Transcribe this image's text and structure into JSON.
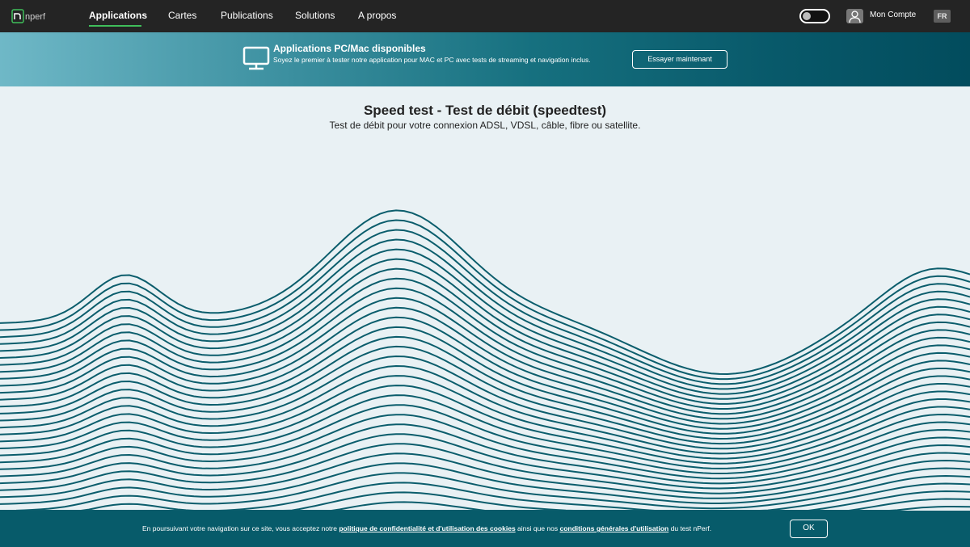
{
  "nav": {
    "logo_text": "nperf",
    "items": [
      "Applications",
      "Cartes",
      "Publications",
      "Solutions",
      "A propos"
    ],
    "active_index": 0,
    "theme_toggle_icon": "sun-icon",
    "account_label": "Mon Compte",
    "account_icon": "user-icon",
    "language": "FR",
    "accent_color": "#3fbe5a"
  },
  "banner": {
    "icon": "monitor-icon",
    "title": "Applications PC/Mac disponibles",
    "text": "Soyez le premier à tester notre application pour MAC et PC avec tests de streaming et navigation inclus.",
    "button_label": "Essayer maintenant"
  },
  "main": {
    "title": "Speed test - Test de débit (speedtest)",
    "subtitle": "Test de débit pour votre connexion ADSL, VDSL, câble, fibre ou satellite.",
    "wave_color": "#0b5d6c"
  },
  "cookie": {
    "text_before": "En poursuivant votre navigation sur ce site, vous acceptez notre ",
    "privacy_link": "politique de confidentialité et d'utilisation des cookies",
    "text_middle": " ainsi que nos ",
    "terms_link": "conditions générales d'utilisation",
    "text_after": " du test nPerf.",
    "ok_label": "OK"
  }
}
